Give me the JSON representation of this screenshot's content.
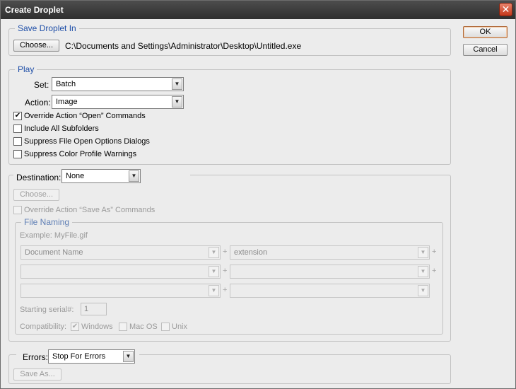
{
  "window": {
    "title": "Create Droplet"
  },
  "buttons": {
    "ok": "OK",
    "cancel": "Cancel"
  },
  "save_droplet": {
    "legend": "Save Droplet In",
    "choose_label": "Choose...",
    "path": "C:\\Documents and Settings\\Administrator\\Desktop\\Untitled.exe"
  },
  "play": {
    "legend": "Play",
    "set_label": "Set:",
    "set_value": "Batch",
    "action_label": "Action:",
    "action_value": "Image",
    "checkboxes": [
      {
        "label": "Override Action “Open” Commands",
        "checked": true
      },
      {
        "label": "Include All Subfolders",
        "checked": false
      },
      {
        "label": "Suppress File Open Options Dialogs",
        "checked": false
      },
      {
        "label": "Suppress Color Profile Warnings",
        "checked": false
      }
    ]
  },
  "destination": {
    "label": "Destination:",
    "value": "None",
    "choose_label": "Choose...",
    "override_label": "Override Action “Save As” Commands"
  },
  "file_naming": {
    "legend": "File Naming",
    "example": "Example: MyFile.gif",
    "rows": [
      {
        "left": "Document Name",
        "right": "extension"
      },
      {
        "left": "",
        "right": ""
      },
      {
        "left": "",
        "right": ""
      }
    ],
    "plus": "+",
    "serial_label": "Starting serial#:",
    "serial_value": "1",
    "compat_label": "Compatibility:",
    "compat": [
      {
        "label": "Windows",
        "checked": true
      },
      {
        "label": "Mac OS",
        "checked": false
      },
      {
        "label": "Unix",
        "checked": false
      }
    ]
  },
  "errors": {
    "label": "Errors:",
    "value": "Stop For Errors",
    "save_as_label": "Save As..."
  },
  "icons": {
    "close": "close-icon",
    "dropdown": "chevron-down-icon",
    "check": "checkmark-icon"
  }
}
